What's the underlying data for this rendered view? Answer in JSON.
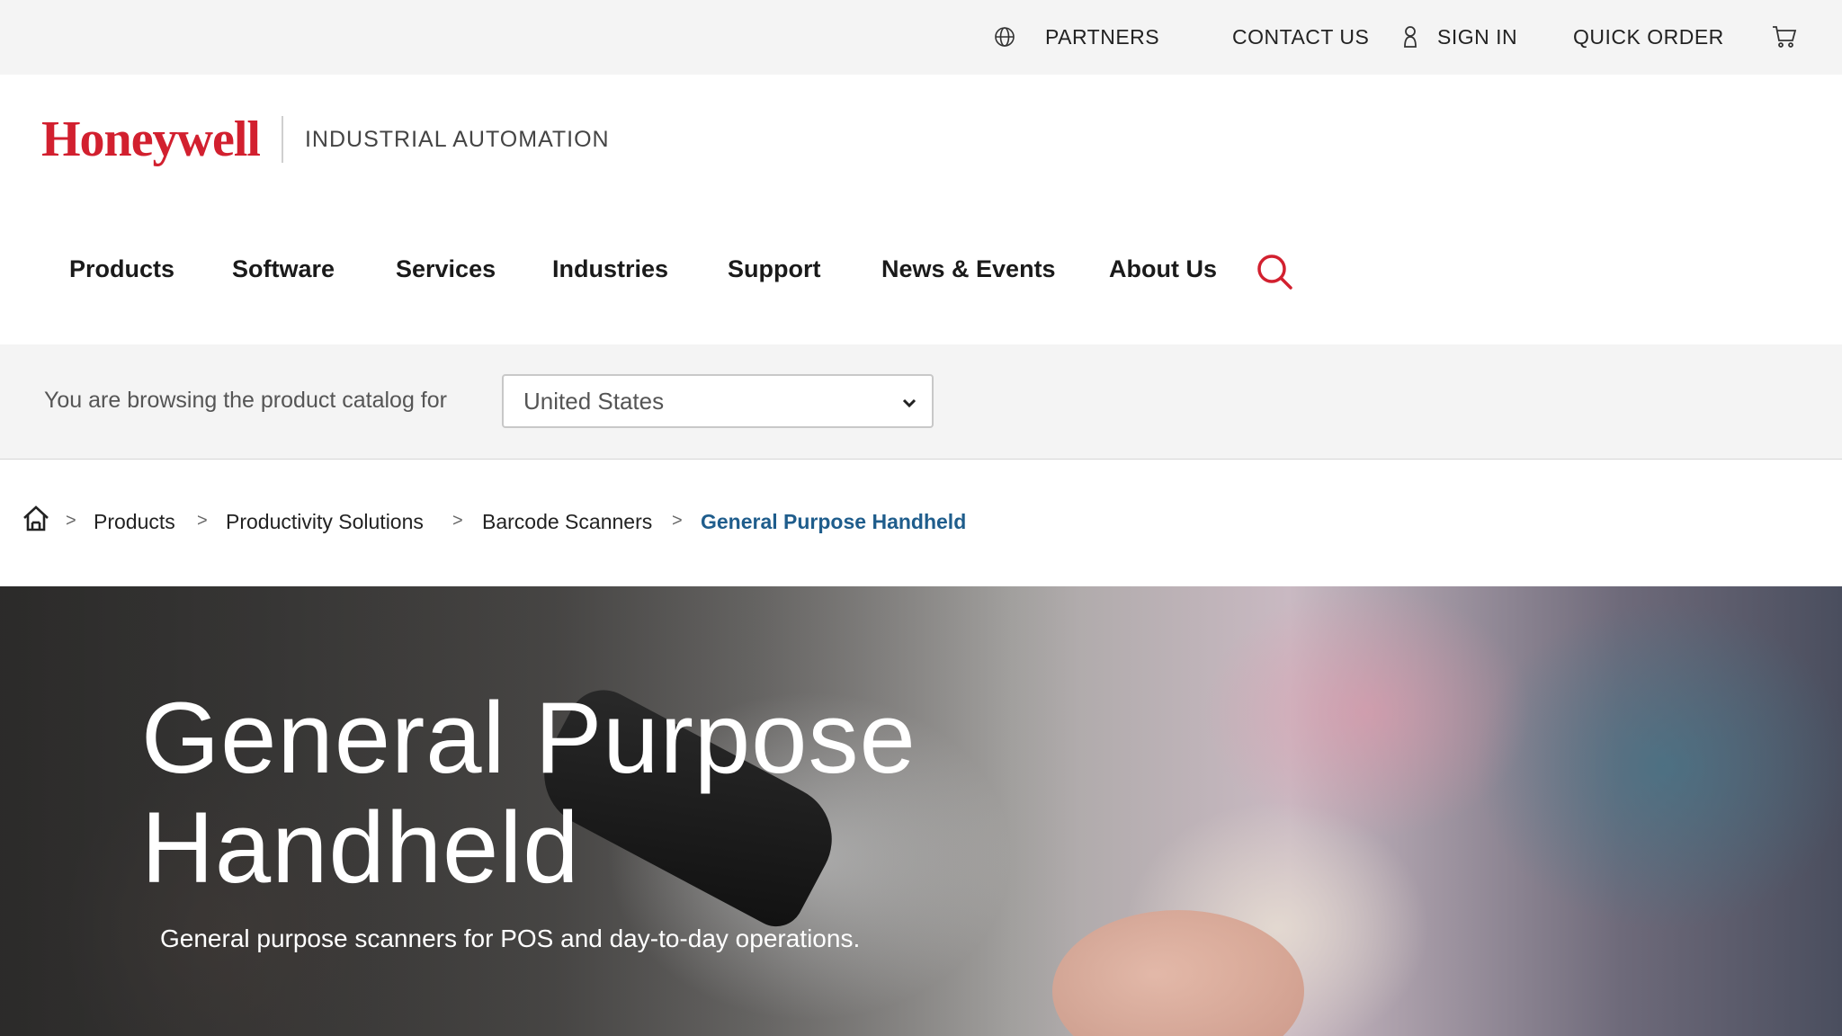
{
  "utility": {
    "partners": "PARTNERS",
    "contact": "CONTACT US",
    "signin": "SIGN IN",
    "quick_order": "QUICK ORDER"
  },
  "brand": {
    "logo": "Honeywell",
    "sub": "INDUSTRIAL AUTOMATION"
  },
  "nav": {
    "items": [
      "Products",
      "Software",
      "Services",
      "Industries",
      "Support",
      "News & Events",
      "About Us"
    ]
  },
  "region": {
    "label": "You are browsing the product catalog for",
    "selected": "United States"
  },
  "breadcrumb": {
    "items": [
      "Products",
      "Productivity Solutions",
      "Barcode Scanners"
    ],
    "current": "General Purpose Handheld"
  },
  "hero": {
    "title_line1": "General Purpose",
    "title_line2": "Handheld",
    "subtitle": "General purpose scanners for POS and day-to-day operations."
  },
  "colors": {
    "brand_red": "#d2202f",
    "breadcrumb_current": "#1f5d8c",
    "utility_bg": "#f4f4f4"
  }
}
